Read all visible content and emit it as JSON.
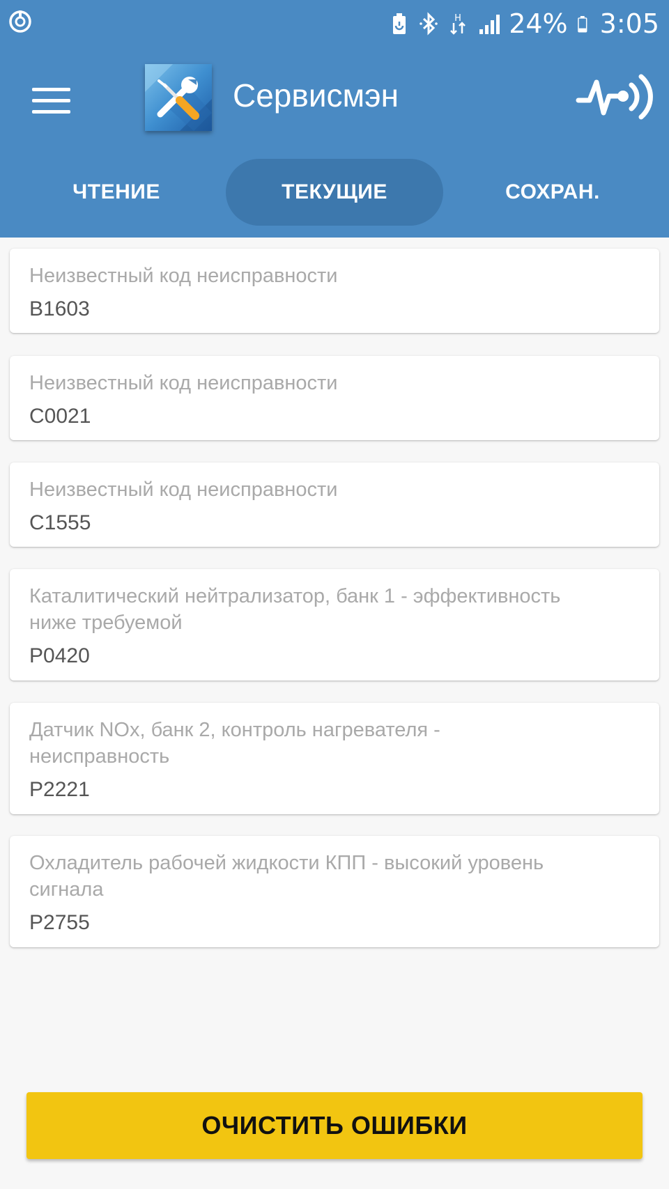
{
  "status_bar": {
    "battery_percent": "24%",
    "time": "3:05",
    "network_type": "H",
    "icons": [
      "sync-icon",
      "battery-saver-icon",
      "bluetooth-icon",
      "data-arrows-icon",
      "signal-icon",
      "battery-icon"
    ]
  },
  "app_bar": {
    "title": "Сервисмэн",
    "logo": "tools-logo",
    "menu_icon": "hamburger-menu-icon",
    "connect_icon": "obd-signal-icon"
  },
  "tabs": [
    {
      "label": "ЧТЕНИЕ",
      "active": false
    },
    {
      "label": "ТЕКУЩИЕ",
      "active": true
    },
    {
      "label": "СОХРАН.",
      "active": false
    }
  ],
  "faults": [
    {
      "desc_lines": [
        "Неизвестный код неисправности"
      ],
      "code": "B1603"
    },
    {
      "desc_lines": [
        "Неизвестный код неисправности"
      ],
      "code": "C0021"
    },
    {
      "desc_lines": [
        "Неизвестный код неисправности"
      ],
      "code": "C1555"
    },
    {
      "desc_lines": [
        "Каталитический нейтрализатор, банк 1 - эффективность",
        "ниже требуемой"
      ],
      "code": "P0420"
    },
    {
      "desc_lines": [
        "Датчик NOx, банк 2, контроль нагревателя -",
        "неисправность"
      ],
      "code": "P2221"
    },
    {
      "desc_lines": [
        "Охладитель рабочей жидкости КПП - высокий уровень",
        "сигнала"
      ],
      "code": "P2755"
    }
  ],
  "actions": {
    "clear_label": "ОЧИСТИТЬ ОШИБКИ"
  },
  "colors": {
    "primary": "#4a8ac3",
    "tab_active": "#3d78ad",
    "accent": "#f2c511",
    "background": "#f7f7f7"
  }
}
